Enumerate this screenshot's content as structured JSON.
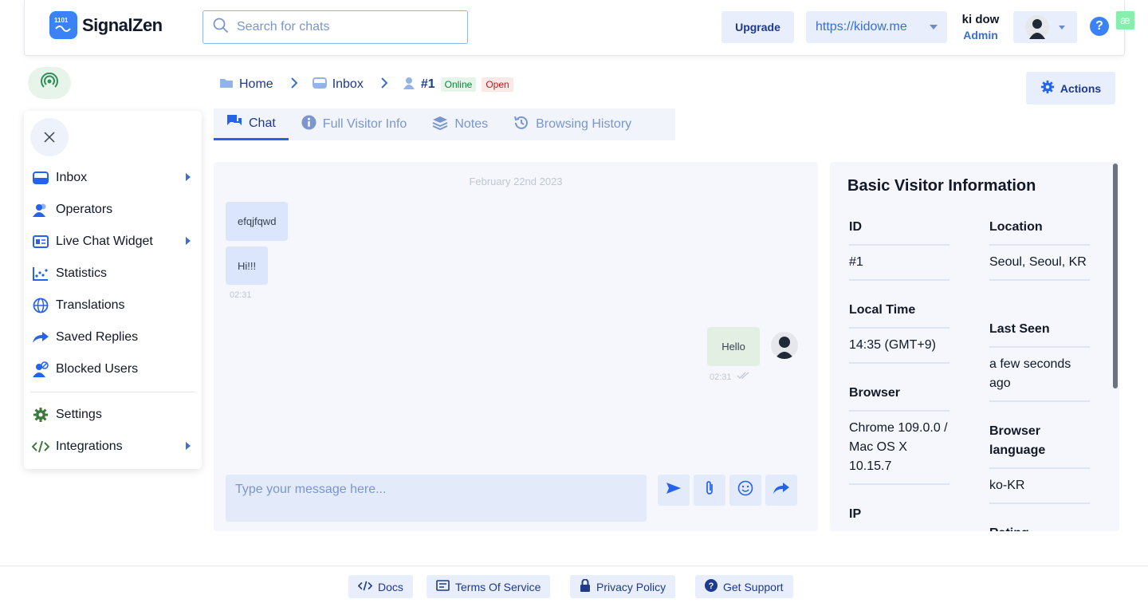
{
  "header": {
    "brand": "SignalZen",
    "search_placeholder": "Search for chats",
    "upgrade_label": "Upgrade",
    "site_url": "https://kidow.me",
    "user_name": "ki dow",
    "user_role": "Admin",
    "help_label": "?",
    "extension_label": "æ"
  },
  "sidebar": {
    "items": [
      {
        "label": "Inbox"
      },
      {
        "label": "Operators"
      },
      {
        "label": "Live Chat Widget"
      },
      {
        "label": "Statistics"
      },
      {
        "label": "Translations"
      },
      {
        "label": "Saved Replies"
      },
      {
        "label": "Blocked Users"
      },
      {
        "label": "Settings"
      },
      {
        "label": "Integrations"
      }
    ]
  },
  "breadcrumb": {
    "home": "Home",
    "inbox": "Inbox",
    "chat": "#1",
    "status_online": "Online",
    "status_open": "Open"
  },
  "actions_label": "Actions",
  "tabs": [
    {
      "label": "Chat"
    },
    {
      "label": "Full Visitor Info"
    },
    {
      "label": "Notes"
    },
    {
      "label": "Browsing History"
    }
  ],
  "chat": {
    "date": "February 22nd 2023",
    "messages": [
      {
        "text": "efqjfqwd",
        "direction": "incoming"
      },
      {
        "text": "Hi!!!",
        "direction": "incoming",
        "time": "02:31"
      },
      {
        "text": "Hello",
        "direction": "outgoing",
        "time": "02:31"
      }
    ],
    "composer_placeholder": "Type your message here..."
  },
  "visitor_info": {
    "title": "Basic Visitor Information",
    "id_label": "ID",
    "id_value": "#1",
    "location_label": "Location",
    "location_value": "Seoul, Seoul, KR",
    "local_time_label": "Local Time",
    "local_time_value": "14:35 (GMT+9)",
    "last_seen_label": "Last Seen",
    "last_seen_value": "a few seconds ago",
    "browser_label": "Browser",
    "browser_value": "Chrome 109.0.0 / Mac OS X 10.15.7",
    "browser_language_label": "Browser language",
    "browser_language_value": "ko-KR",
    "ip_label": "IP",
    "rating_label": "Rating"
  },
  "footer": {
    "docs": "Docs",
    "terms": "Terms Of Service",
    "privacy": "Privacy Policy",
    "support": "Get Support"
  },
  "colors": {
    "accent": "#2563eb",
    "accent_light": "#e8eefb",
    "online_green": "#15803d",
    "open_red": "#b91c1c"
  }
}
